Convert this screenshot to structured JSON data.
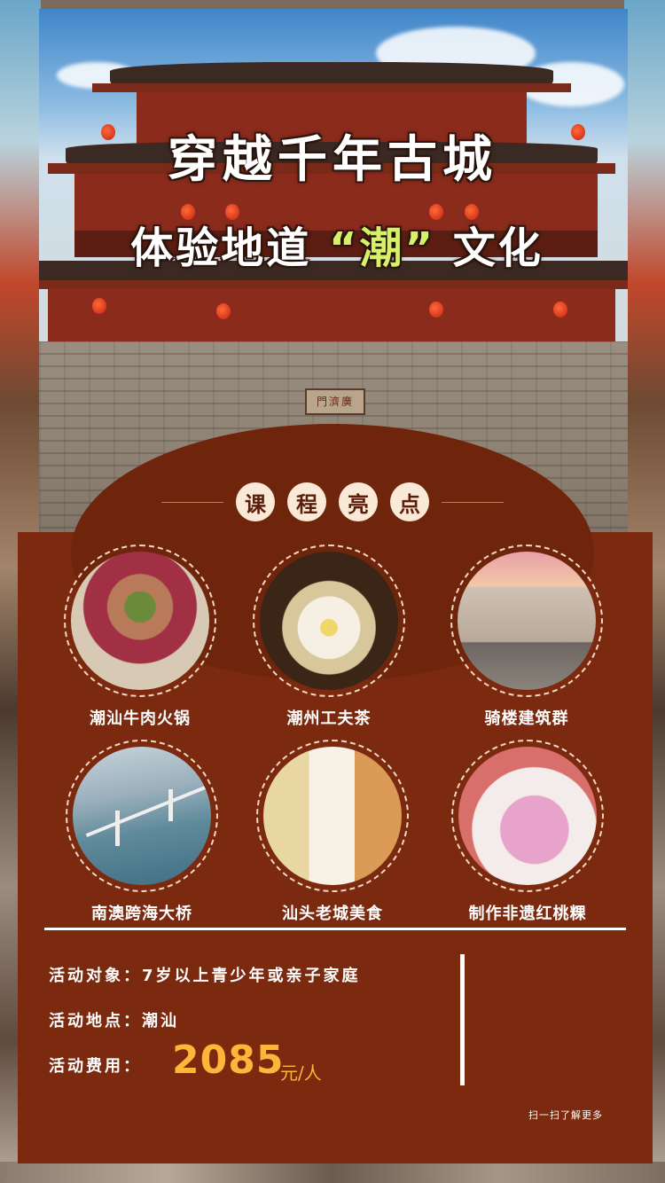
{
  "hero": {
    "title_line1": "穿越千年古城",
    "title_line2_prefix": "体验地道",
    "title_line2_highlight": "“潮”",
    "title_line2_suffix": "文化",
    "gate_plaque": "門濟廣"
  },
  "highlights": {
    "heading_chars": [
      "课",
      "程",
      "亮",
      "点"
    ],
    "items": [
      {
        "label": "潮汕牛肉火锅",
        "icon": "hotpot-photo"
      },
      {
        "label": "潮州工夫茶",
        "icon": "tea-photo"
      },
      {
        "label": "骑楼建筑群",
        "icon": "arcade-photo"
      },
      {
        "label": "南澳跨海大桥",
        "icon": "bridge-photo"
      },
      {
        "label": "汕头老城美食",
        "icon": "food-photo"
      },
      {
        "label": "制作非遗红桃粿",
        "icon": "kueh-photo"
      }
    ]
  },
  "info": {
    "audience": "活动对象：7岁以上青少年或亲子家庭",
    "location": "活动地点：潮汕",
    "fee_label": "活动费用：",
    "fee_value": "2085",
    "fee_unit": "元/人",
    "scan_text": "扫一扫了解更多"
  },
  "colors": {
    "panel": "#7b2a0f",
    "accent_price": "#ffb43a",
    "highlight_text": "#d6f06a"
  }
}
